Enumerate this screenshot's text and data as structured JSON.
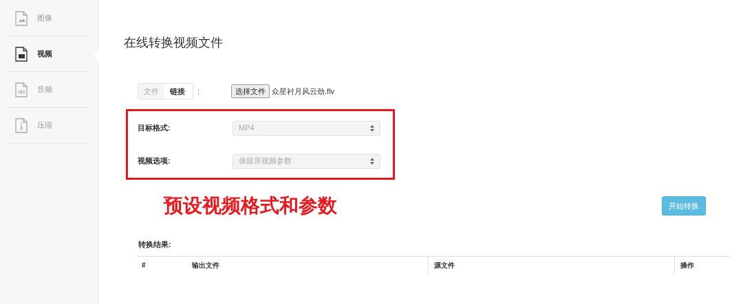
{
  "sidebar": {
    "items": [
      {
        "label": "图像",
        "kind": "image",
        "selected": false
      },
      {
        "label": "视频",
        "kind": "video",
        "selected": true
      },
      {
        "label": "音频",
        "kind": "audio",
        "selected": false
      },
      {
        "label": "压缩",
        "kind": "archive",
        "selected": false
      }
    ]
  },
  "page_title": "在线转换视频文件",
  "source": {
    "tabs": [
      {
        "label": "文件",
        "selected": false
      },
      {
        "label": "链接",
        "selected": true
      }
    ],
    "colon": ":",
    "file_button": "选择文件",
    "file_name": "众星衬月风云劲.flv"
  },
  "options": [
    {
      "label": "目标格式:",
      "value": "MP4"
    },
    {
      "label": "视频选项:",
      "value": "保留原视频参数"
    }
  ],
  "annotation": "预设视频格式和参数",
  "start_button": "开始转换",
  "results": {
    "label": "转换结果:",
    "columns": [
      "#",
      "输出文件",
      "源文件",
      "操作"
    ]
  }
}
